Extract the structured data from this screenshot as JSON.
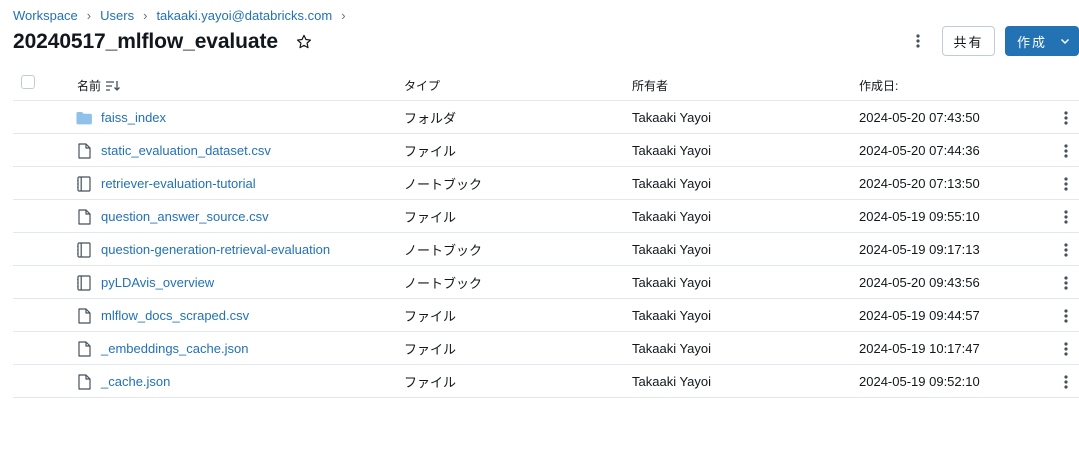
{
  "breadcrumb": [
    "Workspace",
    "Users",
    "takaaki.yayoi@databricks.com"
  ],
  "page_title": "20240517_mlflow_evaluate",
  "actions": {
    "share_label": "共有",
    "create_label": "作成"
  },
  "columns": {
    "name": "名前",
    "type": "タイプ",
    "owner": "所有者",
    "created": "作成日:"
  },
  "rows": [
    {
      "icon": "folder-icon",
      "name": "faiss_index",
      "type": "フォルダ",
      "owner": "Takaaki Yayoi",
      "created": "2024-05-20 07:43:50"
    },
    {
      "icon": "file-icon",
      "name": "static_evaluation_dataset.csv",
      "type": "ファイル",
      "owner": "Takaaki Yayoi",
      "created": "2024-05-20 07:44:36"
    },
    {
      "icon": "notebook-icon",
      "name": "retriever-evaluation-tutorial",
      "type": "ノートブック",
      "owner": "Takaaki Yayoi",
      "created": "2024-05-20 07:13:50"
    },
    {
      "icon": "file-icon",
      "name": "question_answer_source.csv",
      "type": "ファイル",
      "owner": "Takaaki Yayoi",
      "created": "2024-05-19 09:55:10"
    },
    {
      "icon": "notebook-icon",
      "name": "question-generation-retrieval-evaluation",
      "type": "ノートブック",
      "owner": "Takaaki Yayoi",
      "created": "2024-05-19 09:17:13"
    },
    {
      "icon": "notebook-icon",
      "name": "pyLDAvis_overview",
      "type": "ノートブック",
      "owner": "Takaaki Yayoi",
      "created": "2024-05-20 09:43:56"
    },
    {
      "icon": "file-icon",
      "name": "mlflow_docs_scraped.csv",
      "type": "ファイル",
      "owner": "Takaaki Yayoi",
      "created": "2024-05-19 09:44:57"
    },
    {
      "icon": "file-icon",
      "name": "_embeddings_cache.json",
      "type": "ファイル",
      "owner": "Takaaki Yayoi",
      "created": "2024-05-19 10:17:47"
    },
    {
      "icon": "file-icon",
      "name": "_cache.json",
      "type": "ファイル",
      "owner": "Takaaki Yayoi",
      "created": "2024-05-19 09:52:10"
    }
  ],
  "colors": {
    "link": "#2272b4",
    "primary_button": "#2272b4",
    "folder": "#8fc1ea",
    "border": "#e3e8ec"
  }
}
